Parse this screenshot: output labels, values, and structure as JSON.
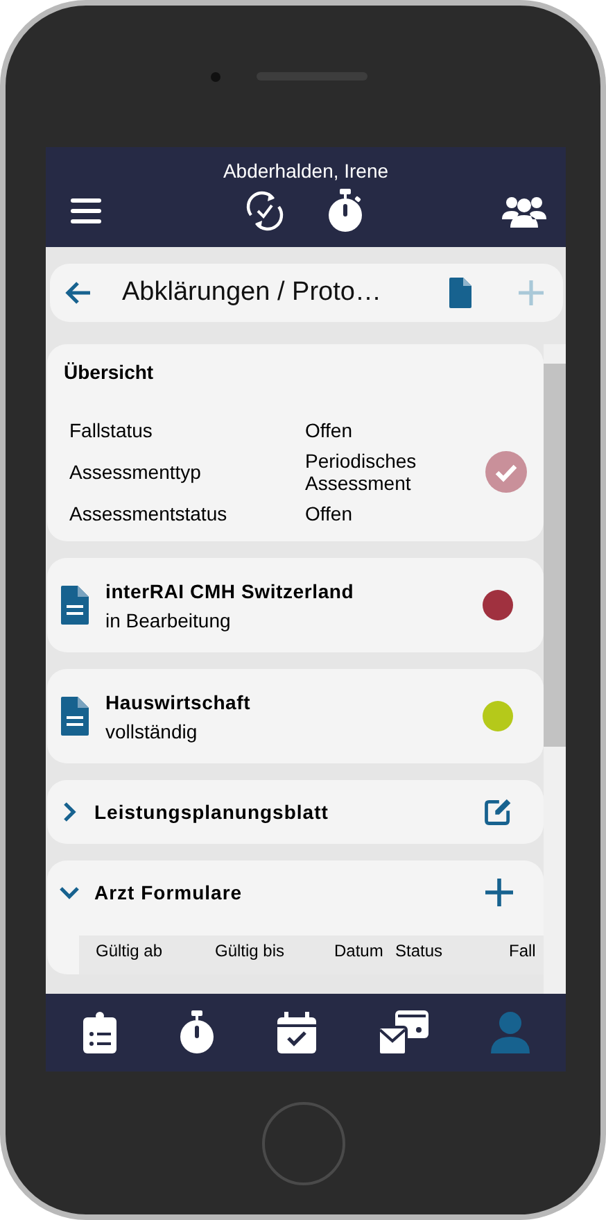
{
  "header": {
    "patient_name": "Abderhalden, Irene"
  },
  "toolbar": {
    "title": "Abklärungen / Proto…"
  },
  "overview": {
    "title": "Übersicht",
    "rows": [
      {
        "label": "Fallstatus",
        "value": "Offen"
      },
      {
        "label": "Assessmenttyp",
        "value": "Periodisches Assessment"
      },
      {
        "label": "Assessmentstatus",
        "value": "Offen"
      }
    ]
  },
  "documents": [
    {
      "title": "interRAI CMH Switzerland",
      "status": "in Bearbeitung",
      "color": "#a0313f"
    },
    {
      "title": "Hauswirtschaft",
      "status": "vollständig",
      "color": "#b5c91a"
    }
  ],
  "sections": [
    {
      "title": "Leistungsplanungsblatt",
      "expanded": false,
      "kind": "edit"
    },
    {
      "title": "Arzt Formulare",
      "expanded": true,
      "kind": "add",
      "columns": [
        "Gültig ab",
        "Gültig bis",
        "Datum",
        "Status",
        "Fall"
      ]
    }
  ],
  "nav": [
    {
      "selected": false
    },
    {
      "selected": false
    },
    {
      "selected": false
    },
    {
      "selected": false
    },
    {
      "selected": true
    }
  ]
}
